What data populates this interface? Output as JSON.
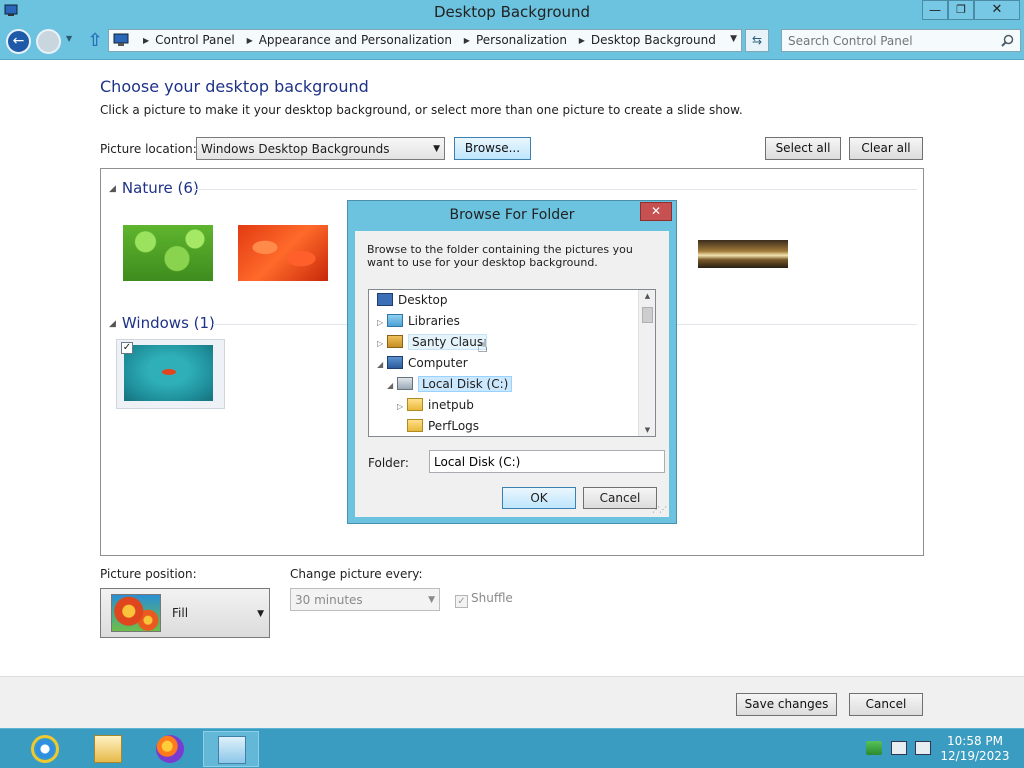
{
  "window": {
    "title": "Desktop Background",
    "minimize_glyph": "—",
    "maximize_glyph": "❐",
    "close_glyph": "✕"
  },
  "nav": {
    "back_glyph": "←",
    "up_glyph": "⇧",
    "breadcrumbs": [
      "Control Panel",
      "Appearance and Personalization",
      "Personalization",
      "Desktop Background"
    ],
    "search_placeholder": "Search Control Panel"
  },
  "main": {
    "heading": "Choose your desktop background",
    "description": "Click a picture to make it your desktop background, or select more than one picture to create a slide show.",
    "picture_location_label": "Picture location:",
    "picture_location_value": "Windows Desktop Backgrounds",
    "browse_label": "Browse...",
    "select_all_label": "Select all",
    "clear_all_label": "Clear all"
  },
  "gallery": {
    "groups": [
      {
        "label": "Nature (6)"
      },
      {
        "label": "Windows (1)"
      }
    ],
    "windows_checked_glyph": "✓"
  },
  "options": {
    "position_label": "Picture position:",
    "position_value": "Fill",
    "change_label": "Change picture every:",
    "change_value": "30 minutes",
    "shuffle_label": "Shuffle",
    "shuffle_checked_glyph": "✓"
  },
  "footer": {
    "save_label": "Save changes",
    "cancel_label": "Cancel"
  },
  "dialog": {
    "title": "Browse For Folder",
    "close_glyph": "✕",
    "description": "Browse to the folder containing the pictures you want to use for your desktop background.",
    "tree": [
      {
        "label": "Desktop"
      },
      {
        "label": "Libraries"
      },
      {
        "label": "Santy Claus"
      },
      {
        "label": "Computer"
      },
      {
        "label": "Local Disk (C:)"
      },
      {
        "label": "inetpub"
      },
      {
        "label": "PerfLogs"
      }
    ],
    "folder_label": "Folder:",
    "folder_value": "Local Disk (C:)",
    "ok_label": "OK",
    "cancel_label": "Cancel"
  },
  "taskbar": {
    "time": "10:58 PM",
    "date": "12/19/2023"
  },
  "colors": {
    "accent_titlebar": "#6cc3e0",
    "taskbar": "#3a9cc0",
    "heading": "#1e3287",
    "dialog_close": "#c75050"
  }
}
